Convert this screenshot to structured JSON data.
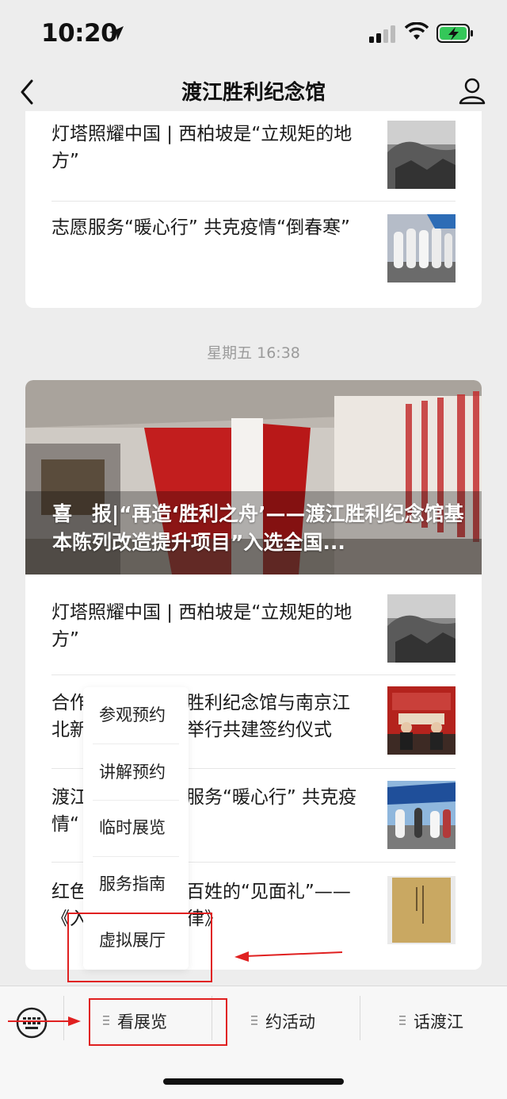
{
  "status_bar": {
    "time": "10:20"
  },
  "nav": {
    "title": "渡江胜利纪念馆"
  },
  "top_card": {
    "items": [
      {
        "title": "灯塔照耀中国 | 西柏坡是“立规矩的地方”"
      },
      {
        "title": "志愿服务“暖心行” 共克疫情“倒春寒”"
      }
    ]
  },
  "timestamp": "星期五 16:38",
  "main_card": {
    "hero_title": "喜　报|“再造‘胜利之舟’——渡江胜利纪念馆基本陈列改造提升项目”入选全国...",
    "items": [
      {
        "title": "灯塔照耀中国 | 西柏坡是“立规矩的地方”"
      },
      {
        "title": "合作",
        "title_hidden": "渡江胜利纪念馆与南京江北新区举行共建签约仪式",
        "visible_lines": [
          "合作",
          "北新",
          "胜利纪念馆与南京江",
          "举行共建签约仪式"
        ]
      },
      {
        "title": "渡江",
        "visible_lines": [
          "渡江",
          "情“",
          "服务“暖心行” 共克疫"
        ]
      },
      {
        "title": "红色",
        "visible_lines": [
          "红色",
          "《入",
          "百姓的“见面礼”——",
          "律》"
        ]
      }
    ]
  },
  "popup_menu": {
    "items": [
      "参观预约",
      "讲解预约",
      "临时展览",
      "服务指南",
      "虚拟展厅"
    ]
  },
  "bottom_menu": {
    "tabs": [
      "看展览",
      "约活动",
      "话渡江"
    ]
  },
  "colors": {
    "annotation": "#e02020",
    "background": "#ededed"
  }
}
